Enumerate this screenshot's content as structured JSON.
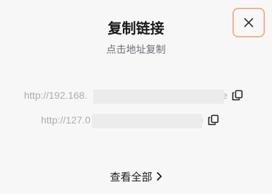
{
  "dialog": {
    "title": "复制链接",
    "subtitle": "点击地址复制",
    "close_icon": "close-icon",
    "accent_border_color": "#f0b48a"
  },
  "links": [
    {
      "text": "http://192.168.                                        d/page",
      "icon": "copy-icon"
    },
    {
      "text": "http://127.0                                   age",
      "icon": "copy-icon"
    }
  ],
  "footer": {
    "view_all_label": "查看全部",
    "chevron_icon": "chevron-right-icon"
  }
}
